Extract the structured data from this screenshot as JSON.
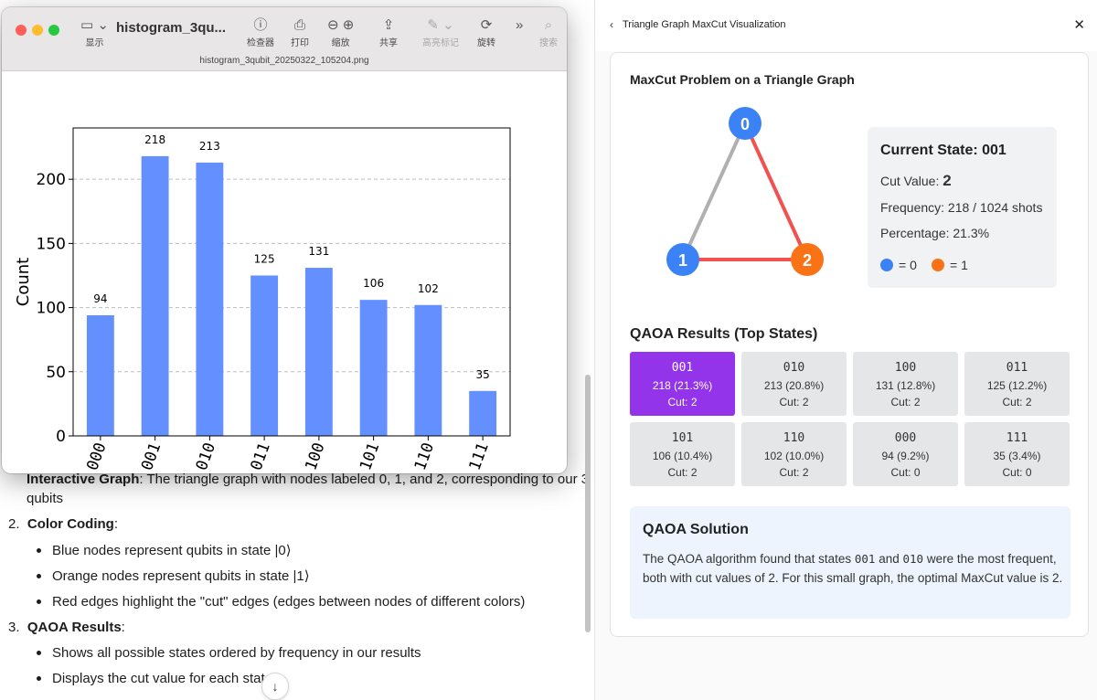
{
  "preview": {
    "title": "histogram_3qu...",
    "filename": "histogram_3qubit_20250322_105204.png",
    "toolbar": {
      "sidebar_label": "显示",
      "inspector_label": "检查器",
      "print_label": "打印",
      "zoom_label": "缩放",
      "share_label": "共享",
      "highlight_label": "高亮标记",
      "rotate_label": "旋转",
      "search_label": "搜索"
    }
  },
  "chart_data": {
    "type": "bar",
    "categories": [
      "000",
      "001",
      "010",
      "011",
      "100",
      "101",
      "110",
      "111"
    ],
    "values": [
      94,
      218,
      213,
      125,
      131,
      106,
      102,
      35
    ],
    "ylabel": "Count",
    "xlabel": "",
    "ylim": [
      0,
      240
    ],
    "yticks": [
      0,
      50,
      100,
      150,
      200
    ],
    "grid": "horizontal dashed",
    "bar_color": "#648fff"
  },
  "doc": {
    "line1_bold": "Interactive Graph",
    "line1_rest": ": The triangle graph with nodes labeled 0, 1, and 2, corresponding to our 3",
    "line1_cont": "qubits",
    "item2_num": "2.",
    "item2_title": "Color Coding",
    "item2_bullets": [
      "Blue nodes represent qubits in state |0⟩",
      "Orange nodes represent qubits in state |1⟩",
      "Red edges highlight the \"cut\" edges (edges between nodes of different colors)"
    ],
    "item3_num": "3.",
    "item3_title": "QAOA Results",
    "item3_bullets": [
      "Shows all possible states ordered by frequency in our results",
      "Displays the cut value for each state"
    ]
  },
  "panel": {
    "back_icon": "chevron-left-icon",
    "title": "Triangle Graph MaxCut Visualization",
    "close_icon": "close-icon",
    "graph_heading": "MaxCut Problem on a Triangle Graph",
    "nodes": [
      "0",
      "1",
      "2"
    ],
    "colors": {
      "blue": "#3b82f6",
      "orange": "#f97316",
      "cut_edge": "#f05252",
      "uncut_edge": "#b0b0b0",
      "accent": "#9333ea"
    },
    "current_state": {
      "title": "Current State: 001",
      "cut_label": "Cut Value:",
      "cut_value": "2",
      "frequency": "Frequency: 218 / 1024 shots",
      "percentage": "Percentage: 21.3%",
      "legend_zero": "= 0",
      "legend_one": "= 1"
    },
    "results_heading": "QAOA Results (Top States)",
    "results": [
      {
        "state": "001",
        "count": "218 (21.3%)",
        "cut": "Cut: 2"
      },
      {
        "state": "010",
        "count": "213 (20.8%)",
        "cut": "Cut: 2"
      },
      {
        "state": "100",
        "count": "131 (12.8%)",
        "cut": "Cut: 2"
      },
      {
        "state": "011",
        "count": "125 (12.2%)",
        "cut": "Cut: 2"
      },
      {
        "state": "101",
        "count": "106 (10.4%)",
        "cut": "Cut: 2"
      },
      {
        "state": "110",
        "count": "102 (10.0%)",
        "cut": "Cut: 2"
      },
      {
        "state": "000",
        "count": "94 (9.2%)",
        "cut": "Cut: 0"
      },
      {
        "state": "111",
        "count": "35 (3.4%)",
        "cut": "Cut: 0"
      }
    ],
    "solution": {
      "title": "QAOA Solution",
      "part1": "The QAOA algorithm found that states ",
      "state_a": "001",
      "part2": " and ",
      "state_b": "010",
      "part3": " were the most frequent, both with cut values of 2. For this small graph, the optimal MaxCut value is 2."
    }
  }
}
